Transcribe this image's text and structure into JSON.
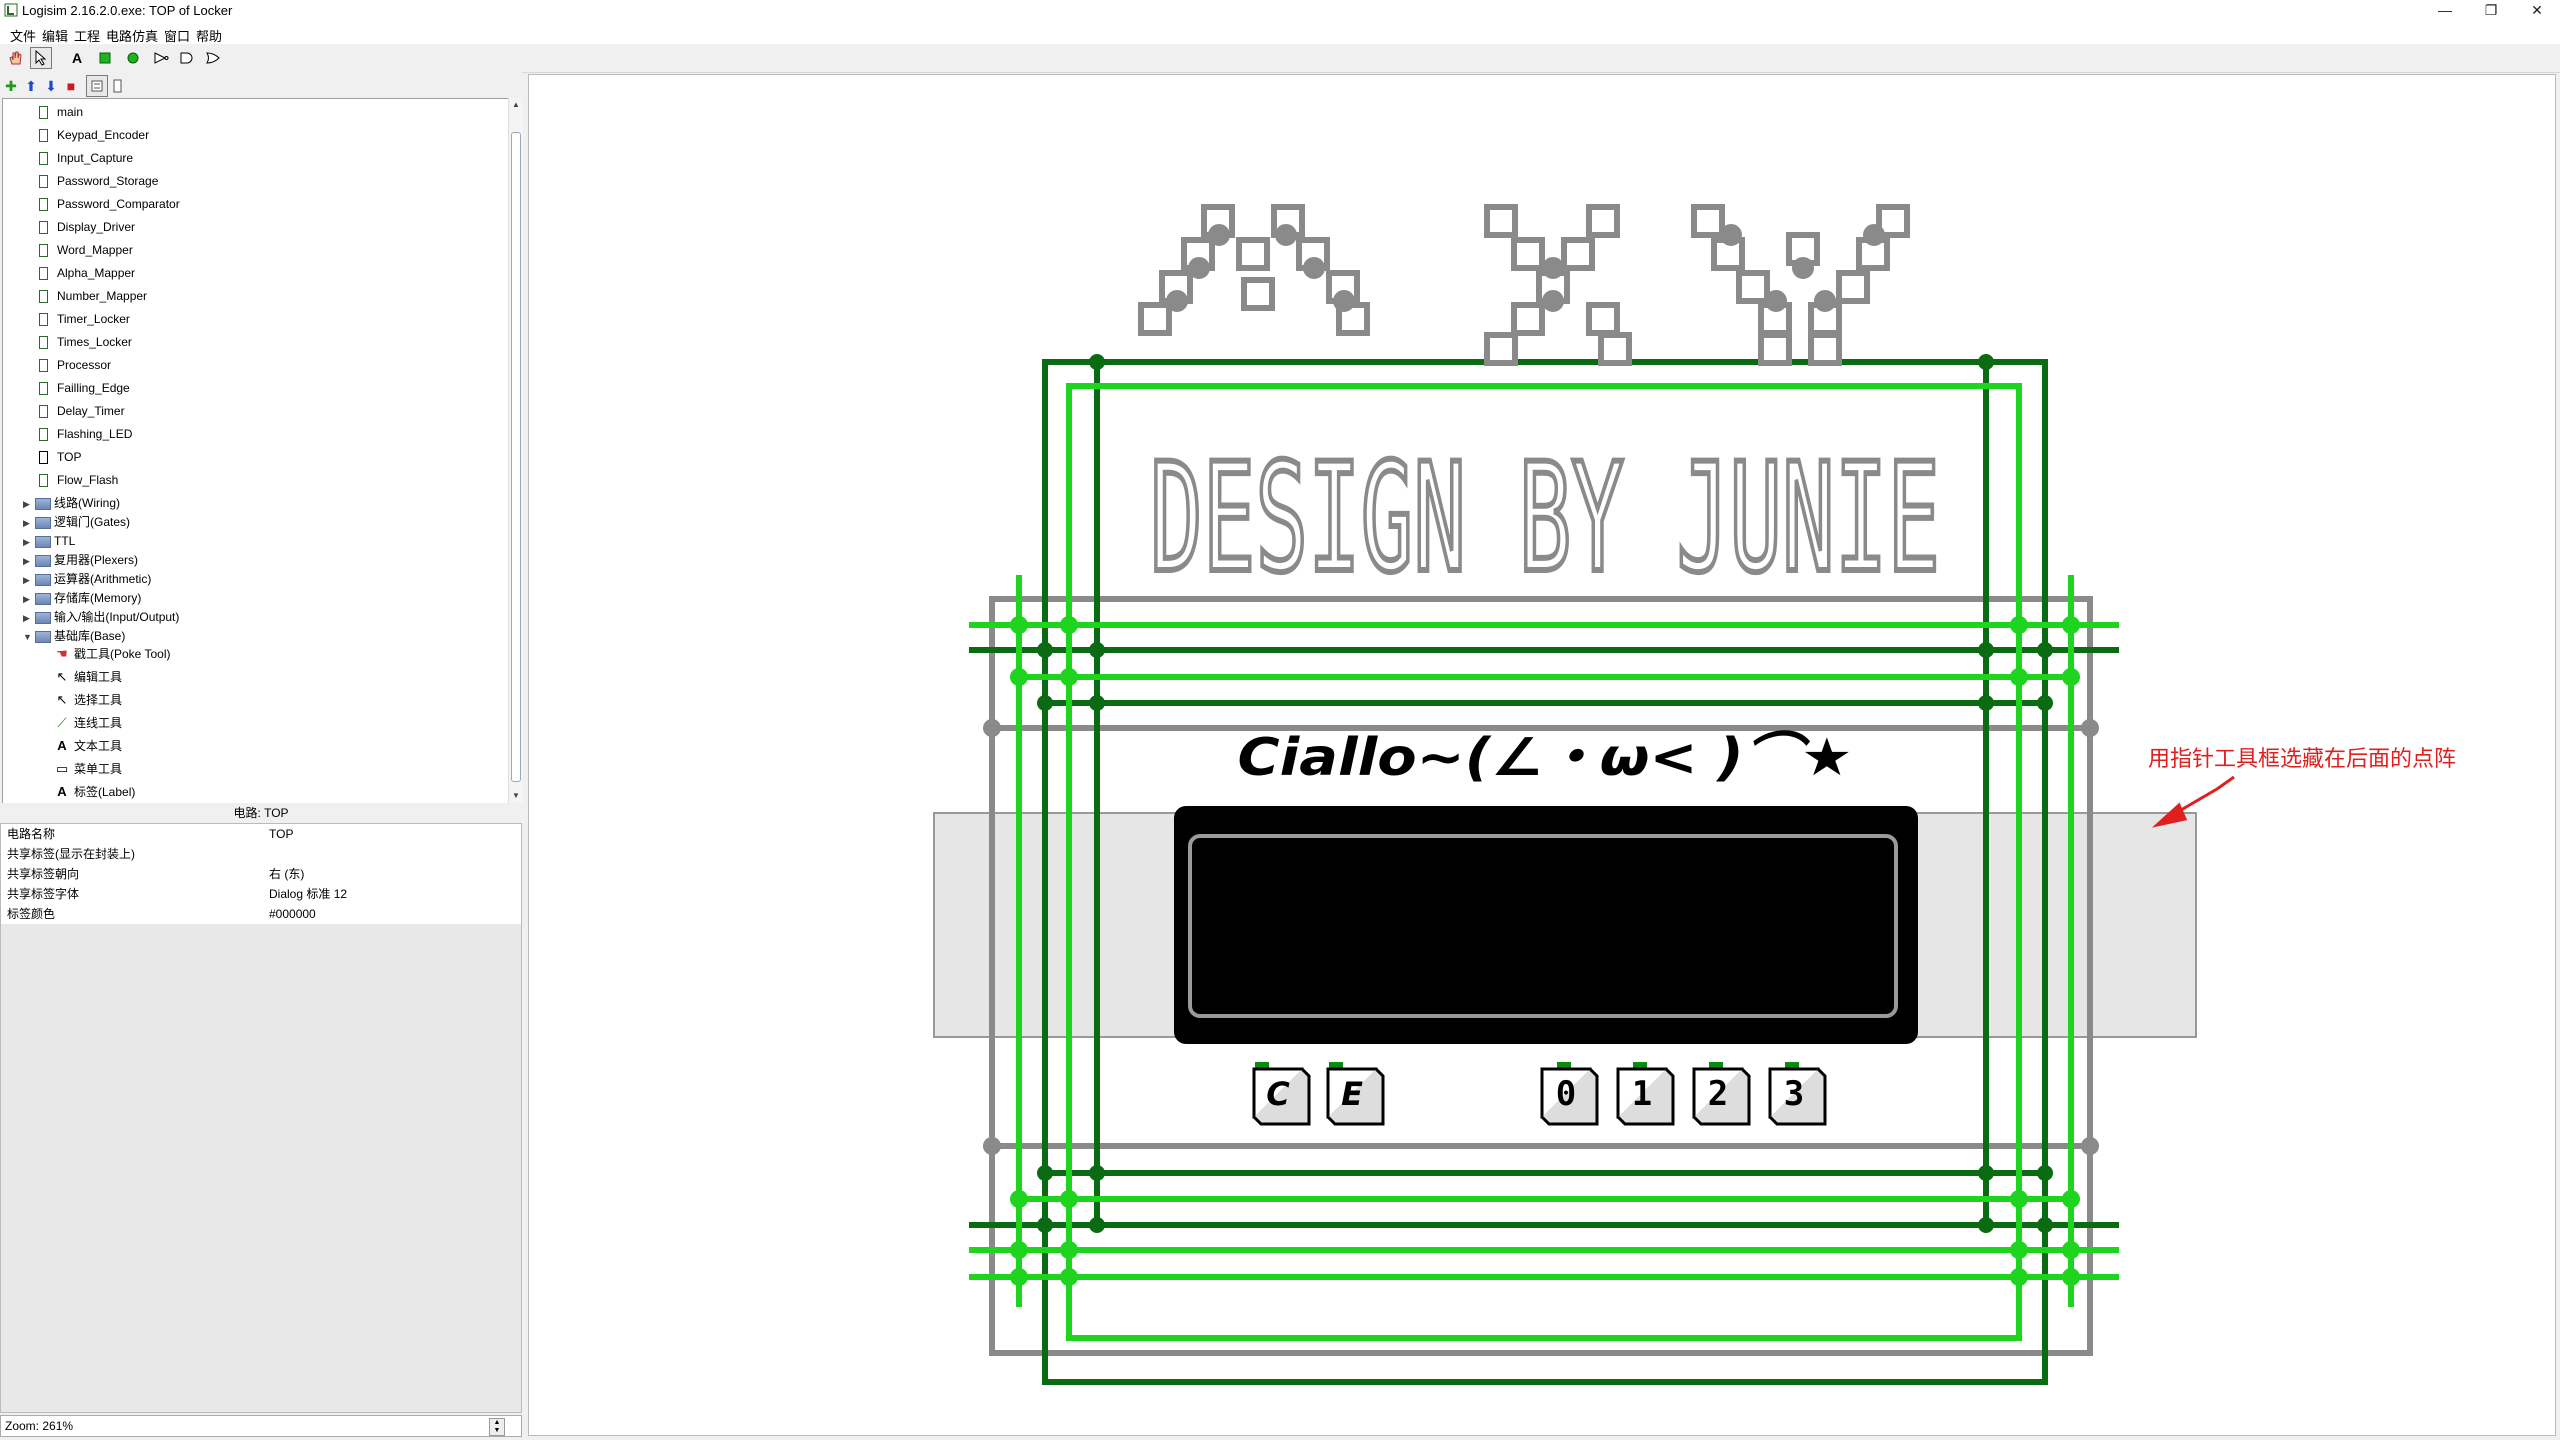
{
  "window": {
    "title": "Logisim 2.16.2.0.exe: TOP of Locker"
  },
  "menu": [
    "文件",
    "编辑",
    "工程",
    "电路仿真",
    "窗口",
    "帮助"
  ],
  "circuits": [
    {
      "label": "main"
    },
    {
      "label": "Keypad_Encoder"
    },
    {
      "label": "Input_Capture"
    },
    {
      "label": "Password_Storage"
    },
    {
      "label": "Password_Comparator"
    },
    {
      "label": "Display_Driver"
    },
    {
      "label": "Word_Mapper"
    },
    {
      "label": "Alpha_Mapper"
    },
    {
      "label": "Number_Mapper"
    },
    {
      "label": "Timer_Locker"
    },
    {
      "label": "Times_Locker"
    },
    {
      "label": "Processor"
    },
    {
      "label": "Failling_Edge"
    },
    {
      "label": "Delay_Timer"
    },
    {
      "label": "Flashing_LED"
    },
    {
      "label": "TOP"
    },
    {
      "label": "Flow_Flash"
    }
  ],
  "libraries": [
    {
      "label": "线路(Wiring)"
    },
    {
      "label": "逻辑门(Gates)"
    },
    {
      "label": "TTL"
    },
    {
      "label": "复用器(Plexers)"
    },
    {
      "label": "运算器(Arithmetic)"
    },
    {
      "label": "存储库(Memory)"
    },
    {
      "label": "输入/输出(Input/Output)"
    },
    {
      "label": "基础库(Base)"
    }
  ],
  "base_tools": [
    {
      "label": "戳工具(Poke Tool)",
      "icon": "poke-icon"
    },
    {
      "label": "编辑工具",
      "icon": "edit-icon"
    },
    {
      "label": "选择工具",
      "icon": "select-icon"
    },
    {
      "label": "连线工具",
      "icon": "wire-icon"
    },
    {
      "label": "文本工具",
      "icon": "text-icon"
    },
    {
      "label": "菜单工具",
      "icon": "menu-icon"
    },
    {
      "label": "标签(Label)",
      "icon": "label-icon"
    }
  ],
  "properties": {
    "header": "电路: TOP",
    "rows": [
      {
        "key": "电路名称",
        "value": "TOP"
      },
      {
        "key": "共享标签(显示在封装上)",
        "value": ""
      },
      {
        "key": "共享标签朝向",
        "value": "右 (东)"
      },
      {
        "key": "共享标签字体",
        "value": "Dialog 标准 12"
      },
      {
        "key": "标签颜色",
        "value": "#000000"
      }
    ]
  },
  "zoom": "Zoom: 261%",
  "canvas": {
    "banner": "DESIGN BY JUNIE",
    "greeting": "Ciallo~(∠・ω< )⌒★",
    "keys": [
      "C",
      "E",
      "0",
      "1",
      "2",
      "3"
    ],
    "annotation": "用指针工具框选藏在后面的点阵"
  },
  "colors": {
    "wire_dark": "#0b6b12",
    "wire_light": "#1fd41f",
    "wire_gray": "#8a8a8a",
    "annotation": "#e0201f",
    "display": "#000000"
  }
}
